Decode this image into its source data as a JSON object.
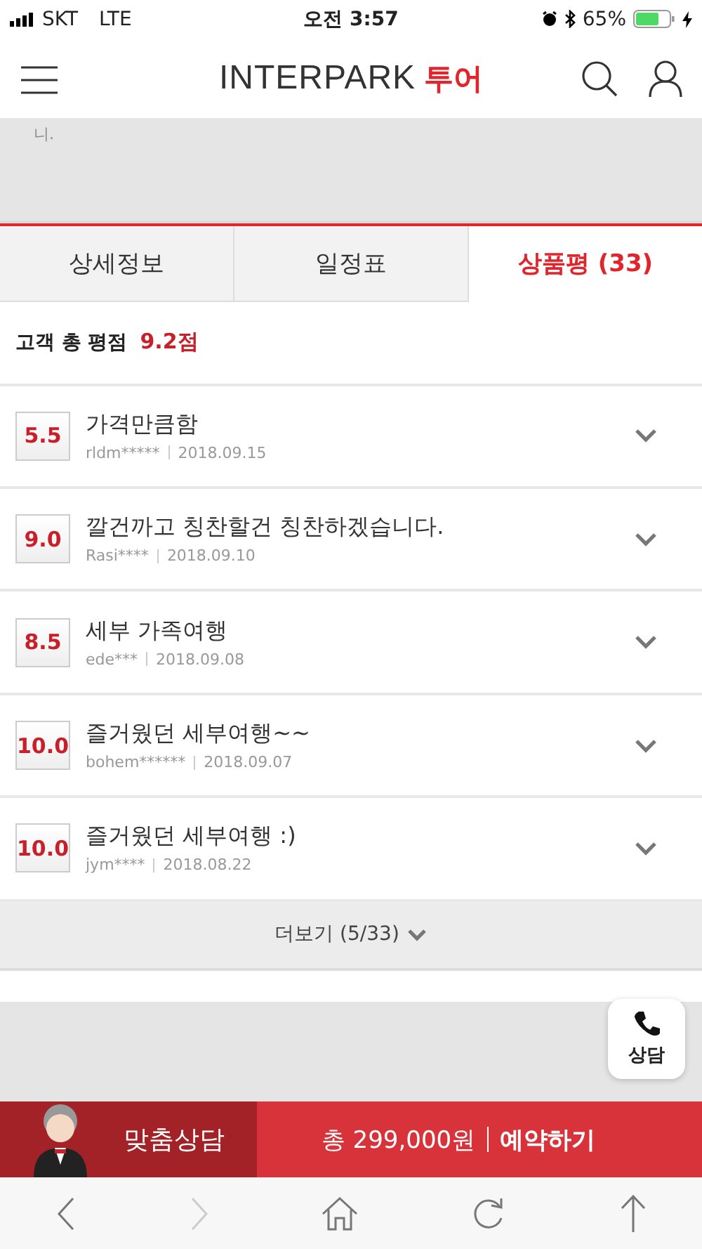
{
  "status_bar": {
    "carrier": "SKT",
    "network": "LTE",
    "time": "오전 3:57",
    "battery": "65%"
  },
  "header": {
    "logo_main": "INTERPARK",
    "logo_sub": "투어"
  },
  "cut_text": "니.",
  "tabs": [
    {
      "label": "상세정보",
      "selected": false
    },
    {
      "label": "일정표",
      "selected": false
    },
    {
      "label": "상품평 (33)",
      "selected": true
    }
  ],
  "rating": {
    "label": "고객 총 평점",
    "score": "9.2점"
  },
  "reviews": [
    {
      "score": "5.5",
      "title": "가격만큼함",
      "user": "rldm*****",
      "date": "2018.09.15",
      "expanded": false
    },
    {
      "score": "9.0",
      "title": "깔건까고 칭찬할건 칭찬하겠습니다.",
      "user": "Rasi****",
      "date": "2018.09.10",
      "expanded": false
    },
    {
      "score": "8.5",
      "title": "세부 가족여행",
      "user": "ede***",
      "date": "2018.09.08",
      "expanded": false
    },
    {
      "score": "10.0",
      "title": "즐거웠던 세부여행~~",
      "user": "bohem******",
      "date": "2018.09.07",
      "expanded": false
    },
    {
      "score": "10.0",
      "title": "즐거웠던 세부여행 :)",
      "user": "jym****",
      "date": "2018.08.22",
      "expanded": false
    }
  ],
  "more_button": "더보기 (5/33)",
  "call_button": "상담",
  "bottom_bar": {
    "consult": "맞춤상담",
    "price": "총 299,000원",
    "book": "예약하기"
  }
}
